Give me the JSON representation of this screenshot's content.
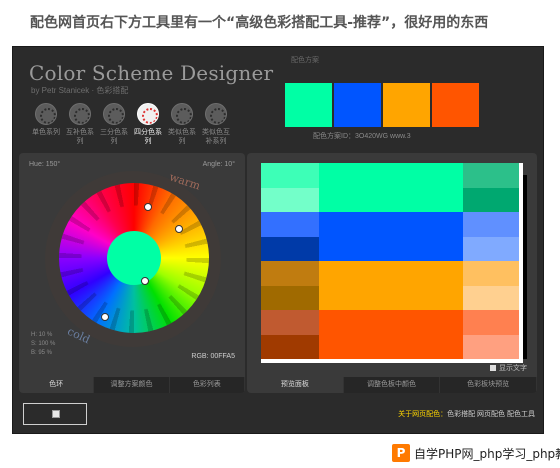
{
  "caption": "配色网首页右下方工具里有一个“高级色彩搭配工具-推荐”，很好用的东西",
  "app": {
    "title": "Color Scheme Designer",
    "subtitle": "by Petr Stanicek · 色彩搭配",
    "palette_label": "配色方案",
    "scheme_id": "配色方案ID：3O420WG  www.3",
    "modes": [
      {
        "label": "单色系列",
        "icon": "mono-icon"
      },
      {
        "label": "互补色系列",
        "icon": "complement-icon"
      },
      {
        "label": "三分色系列",
        "icon": "triad-icon"
      },
      {
        "label": "四分色系列",
        "icon": "tetrad-icon"
      },
      {
        "label": "类似色系列",
        "icon": "analogic-icon"
      },
      {
        "label": "类似色互补系列",
        "icon": "accented-icon"
      }
    ],
    "swatches": [
      "#00ffa5",
      "#0055ff",
      "#ffa500",
      "#ff5500"
    ],
    "left_panel": {
      "hue": "Hue: 150°",
      "angle": "Angle: 10°",
      "warm_label": "warm",
      "cold_label": "cold",
      "stats": [
        "H: 10 %",
        "S: 100 %",
        "B: 95 %"
      ],
      "rgb": "RGB: 00FFA5",
      "tabs": [
        "色环",
        "调整方案颜色",
        "色彩列表"
      ]
    },
    "right_panel": {
      "checkbox_label": "显示文字",
      "tabs": [
        "预览面板",
        "调整色板中颜色",
        "色彩板块预览"
      ]
    },
    "preview_rows": [
      {
        "colors": [
          "#3dffb7",
          "#00ffa5",
          "#00ffa5",
          "#2cc08a"
        ]
      },
      {
        "colors": [
          "#73ffc9",
          "#00ffa5",
          "#00ffa5",
          "#00a870"
        ]
      },
      {
        "colors": [
          "#3370ff",
          "#0055ff",
          "#0055ff",
          "#6090ff"
        ]
      },
      {
        "colors": [
          "#003aa8",
          "#0055ff",
          "#0055ff",
          "#80aaff"
        ]
      },
      {
        "colors": [
          "#c07c10",
          "#ffa500",
          "#ffa500",
          "#ffc060"
        ]
      },
      {
        "colors": [
          "#a06a00",
          "#ffa500",
          "#ffa500",
          "#ffd090"
        ]
      },
      {
        "colors": [
          "#c05a30",
          "#ff5500",
          "#ff5500",
          "#ff8050"
        ]
      },
      {
        "colors": [
          "#a03a00",
          "#ff5500",
          "#ff5500",
          "#ffa080"
        ]
      }
    ],
    "footer": {
      "links_hl": "关于网页配色：",
      "links": "色彩搭配  网页配色  配色工具"
    }
  },
  "watermark": {
    "logo": "P",
    "text": "自学PHP网_php学习_php教程"
  }
}
